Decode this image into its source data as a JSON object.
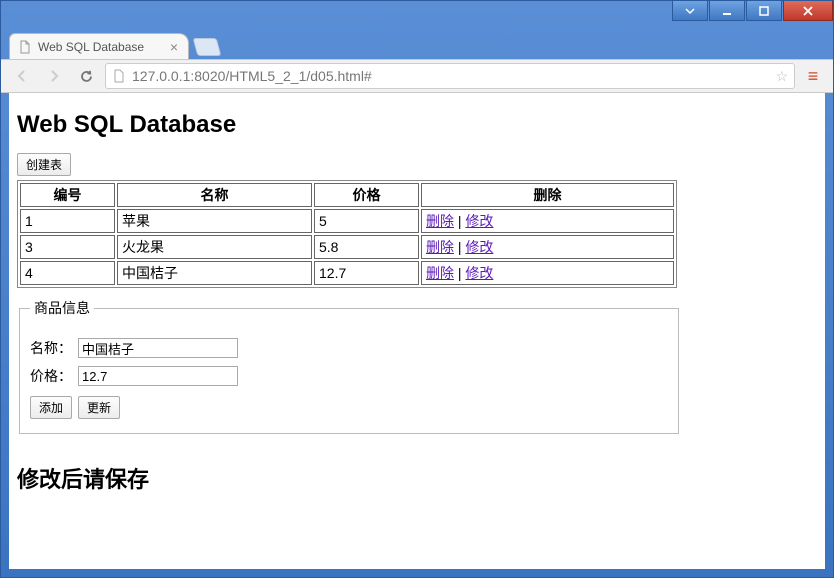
{
  "window": {
    "tab_title": "Web SQL Database",
    "url": "127.0.0.1:8020/HTML5_2_1/d05.html#"
  },
  "page": {
    "heading": "Web SQL Database",
    "create_table_btn": "创建表",
    "footer_heading": "修改后请保存"
  },
  "table": {
    "headers": {
      "id": "编号",
      "name": "名称",
      "price": "价格",
      "action": "删除"
    },
    "action_labels": {
      "delete": "删除",
      "edit": "修改",
      "sep": " | "
    },
    "rows": [
      {
        "id": "1",
        "name": "苹果",
        "price": "5"
      },
      {
        "id": "3",
        "name": "火龙果",
        "price": "5.8"
      },
      {
        "id": "4",
        "name": "中国桔子",
        "price": "12.7"
      }
    ]
  },
  "form": {
    "legend": "商品信息",
    "name_label": "名称：",
    "price_label": "价格：",
    "name_value": "中国桔子",
    "price_value": "12.7",
    "add_btn": "添加",
    "update_btn": "更新"
  }
}
